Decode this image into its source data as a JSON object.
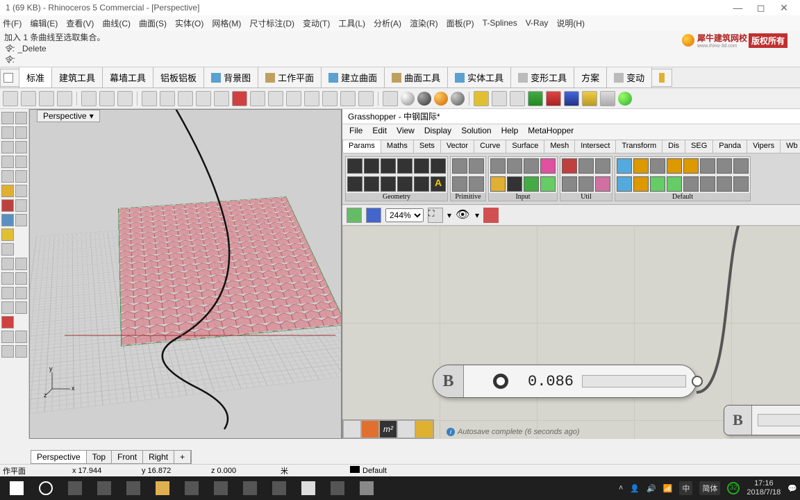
{
  "title": "1 (69 KB) - Rhinoceros 5 Commercial - [Perspective]",
  "menubar": [
    "件(F)",
    "编辑(E)",
    "查看(V)",
    "曲线(C)",
    "曲面(S)",
    "实体(O)",
    "网格(M)",
    "尺寸标注(D)",
    "变动(T)",
    "工具(L)",
    "分析(A)",
    "渲染(R)",
    "面板(P)",
    "T-Splines",
    "V-Ray",
    "说明(H)"
  ],
  "cmd": {
    "line1": "加入 1 条曲线至选取集合。",
    "prompt": "令:",
    "entry": "_Delete",
    "prompt2": "令:"
  },
  "tabs": [
    "标准",
    "建筑工具",
    "幕墙工具",
    "铝板铝板",
    "背景图",
    "工作平面",
    "建立曲面",
    "曲面工具",
    "实体工具",
    "变形工具",
    "方案",
    "变动"
  ],
  "active_tab": 0,
  "viewport_label": "Perspective",
  "vp_tabs": [
    "Perspective",
    "Top",
    "Front",
    "Right",
    "+"
  ],
  "status": {
    "plane": "作平面",
    "x": "x 17.944",
    "y": "y 16.872",
    "z": "z 0.000",
    "unit": "米",
    "layer": "Default"
  },
  "gh": {
    "title": "Grasshopper - 中钢国际*",
    "menu": [
      "File",
      "Edit",
      "View",
      "Display",
      "Solution",
      "Help",
      "MetaHopper"
    ],
    "tabs": [
      "Params",
      "Maths",
      "Sets",
      "Vector",
      "Curve",
      "Surface",
      "Mesh",
      "Intersect",
      "Transform",
      "Dis",
      "SEG",
      "Panda",
      "Vipers",
      "Wb"
    ],
    "active_tab": 0,
    "groups": [
      "Geometry",
      "Primitive",
      "Input",
      "Util",
      "Default"
    ],
    "zoom": "244%",
    "slider": {
      "label": "B",
      "value": "0.086"
    },
    "comp2_label": "B",
    "status": "Autosave complete (6 seconds ago)"
  },
  "watermark": {
    "text1": "犀牛建筑网校",
    "sub": "www.rhino-3d.com",
    "text2": "版权所有"
  },
  "taskbar": {
    "ime1": "中",
    "ime2": "简体",
    "badge": "32",
    "time": "17:16",
    "date": "2018/7/18"
  }
}
